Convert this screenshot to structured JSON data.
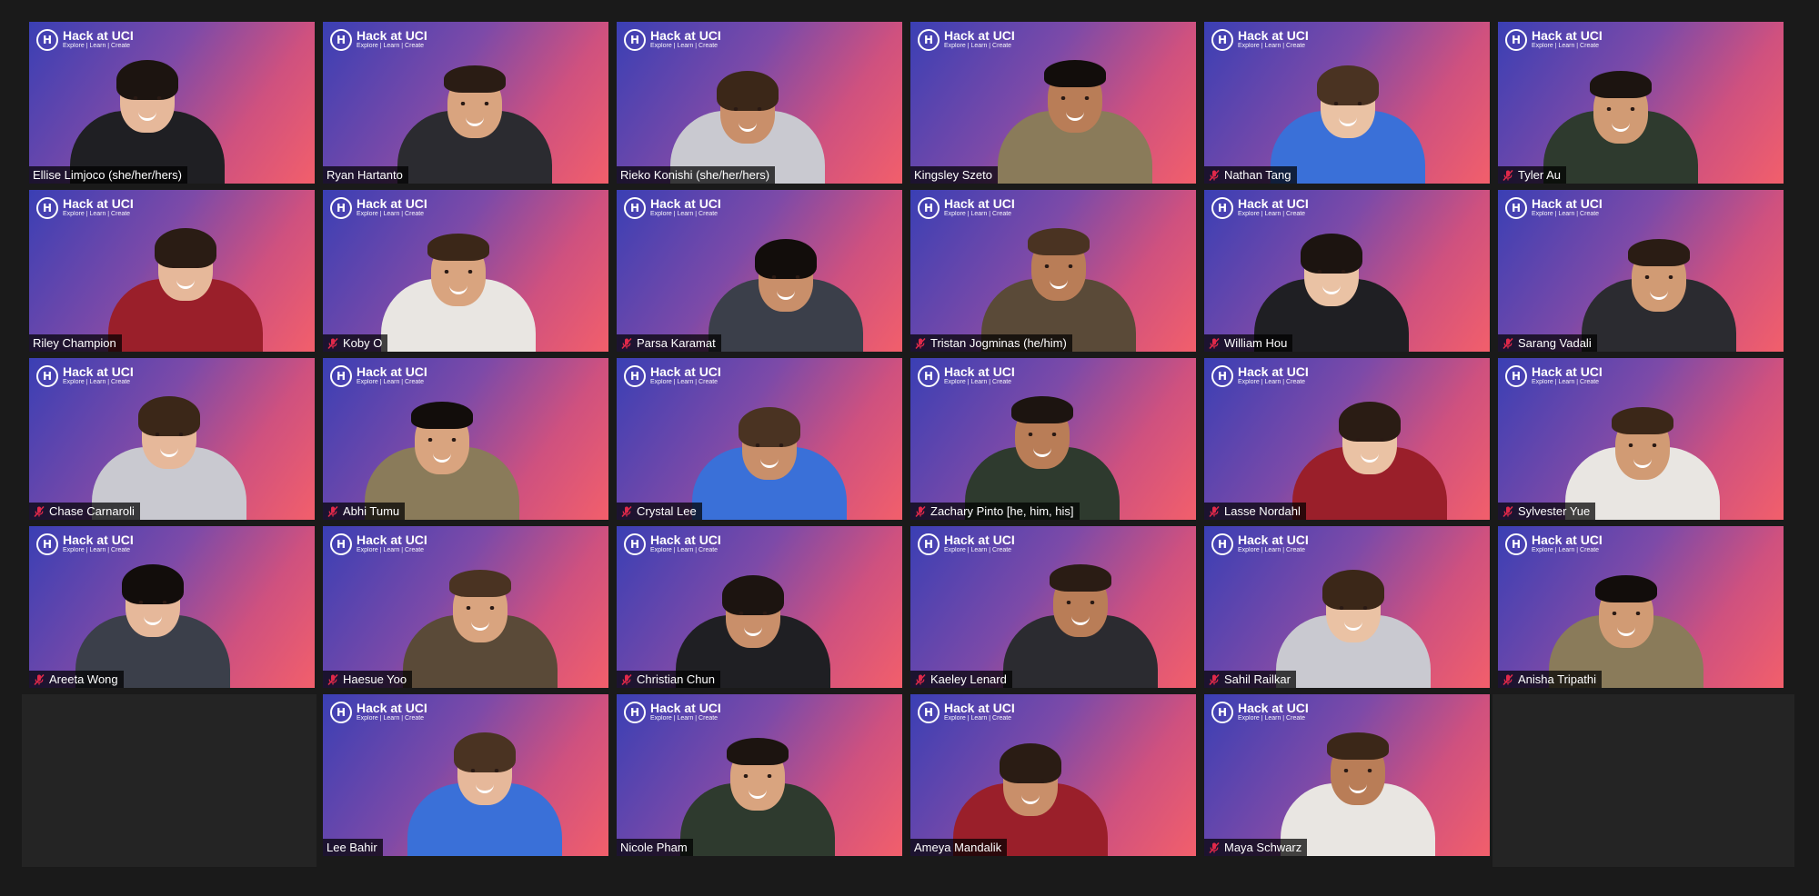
{
  "app": {
    "view": "Gallery View"
  },
  "branding": {
    "logo_title": "Hack at UCI",
    "logo_tagline": "Explore | Learn | Create",
    "logo_mark": "H"
  },
  "colors": {
    "background": "#1a1a1a",
    "empty_cell": "#242424",
    "gradient_start": "#3a3fb4",
    "gradient_end": "#f25f6b",
    "muted_icon": "#e0294a"
  },
  "icons": {
    "muted": "microphone-muted-icon",
    "logo": "hack-at-uci-logo-icon"
  },
  "participants": [
    {
      "name": "Ellise Limjoco (she/her/hers)",
      "muted": false
    },
    {
      "name": "Ryan Hartanto",
      "muted": false
    },
    {
      "name": "Rieko Konishi (she/her/hers)",
      "muted": false
    },
    {
      "name": "Kingsley Szeto",
      "muted": false
    },
    {
      "name": "Nathan Tang",
      "muted": true
    },
    {
      "name": "Tyler Au",
      "muted": true
    },
    {
      "name": "Riley Champion",
      "muted": false
    },
    {
      "name": "Koby O",
      "muted": true
    },
    {
      "name": "Parsa Karamat",
      "muted": true
    },
    {
      "name": "Tristan Jogminas (he/him)",
      "muted": true
    },
    {
      "name": "William Hou",
      "muted": true
    },
    {
      "name": "Sarang Vadali",
      "muted": true
    },
    {
      "name": "Chase Carnaroli",
      "muted": true
    },
    {
      "name": "Abhi Tumu",
      "muted": true
    },
    {
      "name": "Crystal Lee",
      "muted": true
    },
    {
      "name": "Zachary Pinto [he, him, his]",
      "muted": true
    },
    {
      "name": "Lasse Nordahl",
      "muted": true
    },
    {
      "name": "Sylvester Yue",
      "muted": true
    },
    {
      "name": "Areeta Wong",
      "muted": true
    },
    {
      "name": "Haesue Yoo",
      "muted": true
    },
    {
      "name": "Christian Chun",
      "muted": true
    },
    {
      "name": "Kaeley Lenard",
      "muted": true
    },
    {
      "name": "Sahil Railkar",
      "muted": true
    },
    {
      "name": "Anisha Tripathi",
      "muted": true
    },
    {
      "name": "Lee Bahir",
      "muted": false
    },
    {
      "name": "Nicole Pham",
      "muted": false
    },
    {
      "name": "Ameya Mandalik",
      "muted": false
    },
    {
      "name": "Maya Schwarz",
      "muted": true
    }
  ]
}
